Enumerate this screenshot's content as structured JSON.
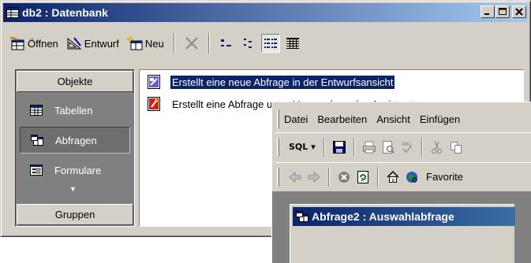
{
  "db_window": {
    "title": "db2 : Datenbank",
    "controls": {
      "minimize": "_",
      "maximize": "□",
      "close": "×"
    },
    "toolbar": {
      "open_label": "Öffnen",
      "design_label": "Entwurf",
      "new_label": "Neu"
    },
    "objects_bar": {
      "header": "Objekte",
      "items": [
        {
          "label": "Tabellen",
          "icon": "table-icon"
        },
        {
          "label": "Abfragen",
          "icon": "query-icon",
          "selected": true
        },
        {
          "label": "Formulare",
          "icon": "form-icon"
        }
      ],
      "groups_label": "Gruppen"
    },
    "list": [
      {
        "text": "Erstellt eine neue Abfrage in der Entwurfsansicht",
        "selected": true
      },
      {
        "text": "Erstellt eine Abfrage unter Verwendung des Assistenten",
        "selected": false
      }
    ]
  },
  "ie_window": {
    "menu": [
      "Datei",
      "Bearbeiten",
      "Ansicht",
      "Einfügen"
    ],
    "sql_label": "SQL",
    "favorites_label": "Favorite",
    "child_window_title": "Abfrage2 : Auswahlabfrage"
  },
  "colors": {
    "title_active": "#0a246a",
    "face": "#d4d0c8",
    "selection": "#0a246a"
  }
}
